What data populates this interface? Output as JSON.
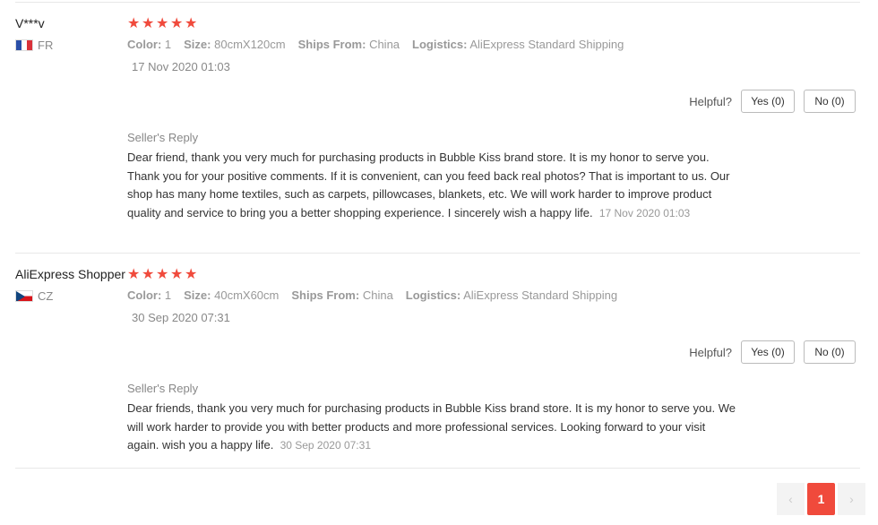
{
  "reviews": [
    {
      "user": "V***v",
      "country": "FR",
      "stars": "★★★★★",
      "props": {
        "color_key": "Color:",
        "color_val": "1",
        "size_key": "Size:",
        "size_val": "80cmX120cm",
        "ships_key": "Ships From:",
        "ships_val": "China",
        "logistics_key": "Logistics:",
        "logistics_val": "AliExpress Standard Shipping"
      },
      "date": "17 Nov 2020 01:03",
      "helpful_label": "Helpful?",
      "yes_label": "Yes (0)",
      "no_label": "No (0)",
      "reply_title": "Seller's Reply",
      "reply_text": "Dear friend, thank you very much for purchasing products in Bubble Kiss brand store. It is my honor to serve you. Thank you for your positive comments. If it is convenient, can you feed back real photos? That is important to us. Our shop has many home textiles, such as carpets, pillowcases, blankets, etc. We will work harder to improve product quality and service to bring you a better shopping experience. I sincerely wish a happy life.",
      "reply_date": "17 Nov 2020 01:03"
    },
    {
      "user": "AliExpress Shopper",
      "country": "CZ",
      "stars": "★★★★★",
      "props": {
        "color_key": "Color:",
        "color_val": "1",
        "size_key": "Size:",
        "size_val": "40cmX60cm",
        "ships_key": "Ships From:",
        "ships_val": "China",
        "logistics_key": "Logistics:",
        "logistics_val": "AliExpress Standard Shipping"
      },
      "date": "30 Sep 2020 07:31",
      "helpful_label": "Helpful?",
      "yes_label": "Yes (0)",
      "no_label": "No (0)",
      "reply_title": "Seller's Reply",
      "reply_text": "Dear friends, thank you very much for purchasing products in Bubble Kiss brand store. It is my honor to serve you. We will work harder to provide you with better products and more professional services. Looking forward to your visit again. wish you a happy life.",
      "reply_date": "30 Sep 2020 07:31"
    }
  ],
  "pagination": {
    "prev": "‹",
    "current": "1",
    "next": "›"
  },
  "colors": {
    "star": "#f04a3c",
    "page_active": "#f04a3c"
  }
}
